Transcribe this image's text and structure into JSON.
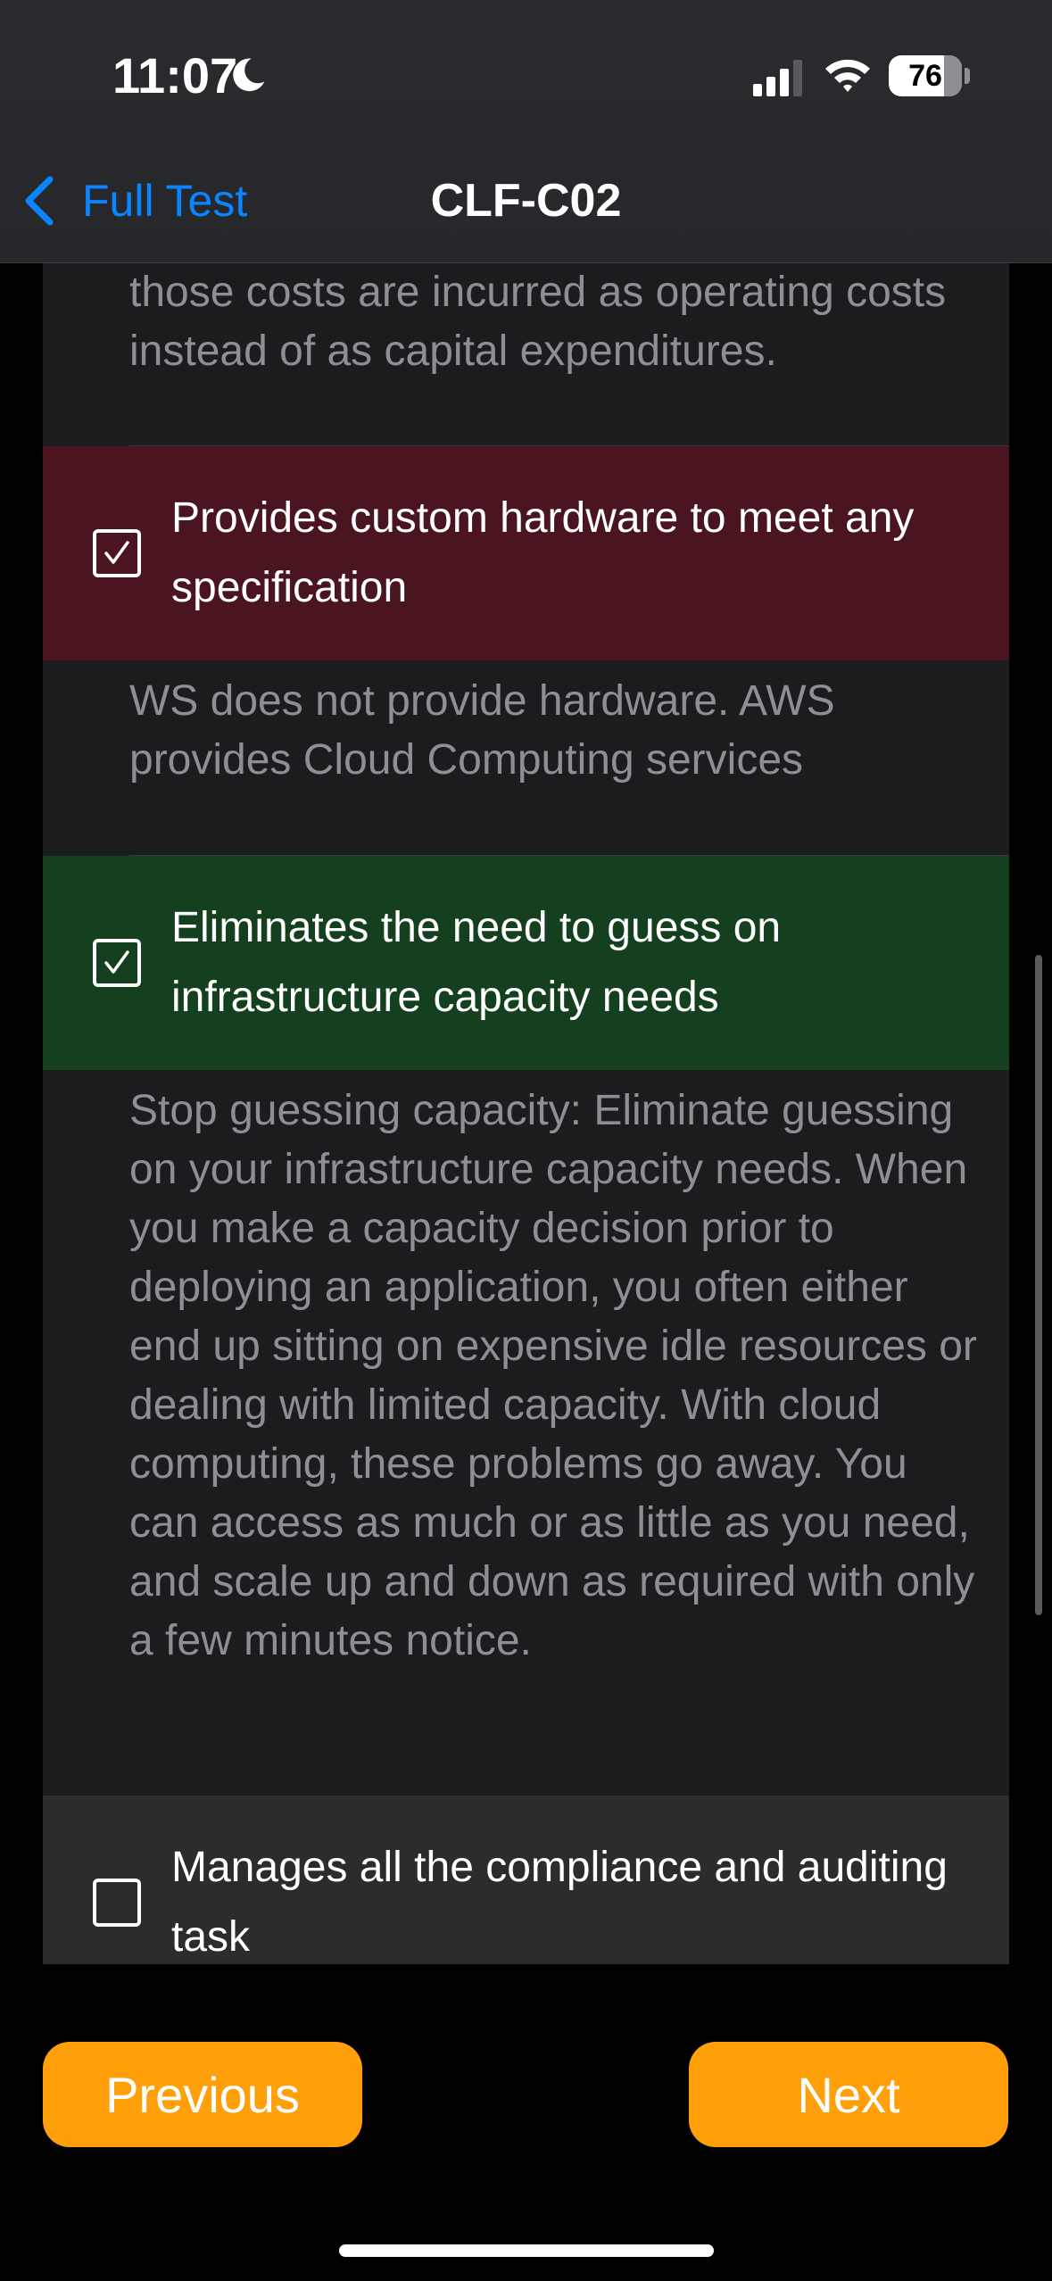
{
  "status_bar": {
    "time": "11:07",
    "battery": "76"
  },
  "nav": {
    "back_label": "Full Test",
    "title": "CLF-C02"
  },
  "content": {
    "top_explanation": "those costs are incurred as operating costs instead of as capital expenditures.",
    "options": [
      {
        "text": "Provides custom hardware to meet any specification",
        "checked": true,
        "state": "wrong",
        "explanation": "WS does not provide hardware. AWS provides Cloud Computing services"
      },
      {
        "text": "Eliminates the need to guess on infrastructure capacity needs",
        "checked": true,
        "state": "correct",
        "explanation": "Stop guessing capacity: Eliminate guessing on your infrastructure capacity needs. When you make a capacity decision prior to deploying an application, you often either end up sitting on expensive idle resources or dealing with limited capacity. With cloud computing, these problems go away. You can access as much or as little as you need, and scale up and down as required with only a few minutes notice."
      },
      {
        "text": "Manages all the compliance and auditing task",
        "checked": false,
        "state": "unselected"
      }
    ]
  },
  "footer": {
    "previous_label": "Previous",
    "next_label": "Next"
  },
  "colors": {
    "accent": "#0a84ff",
    "button": "#ff9f0a",
    "wrong_bg": "#4b1520",
    "correct_bg": "#15401f"
  }
}
